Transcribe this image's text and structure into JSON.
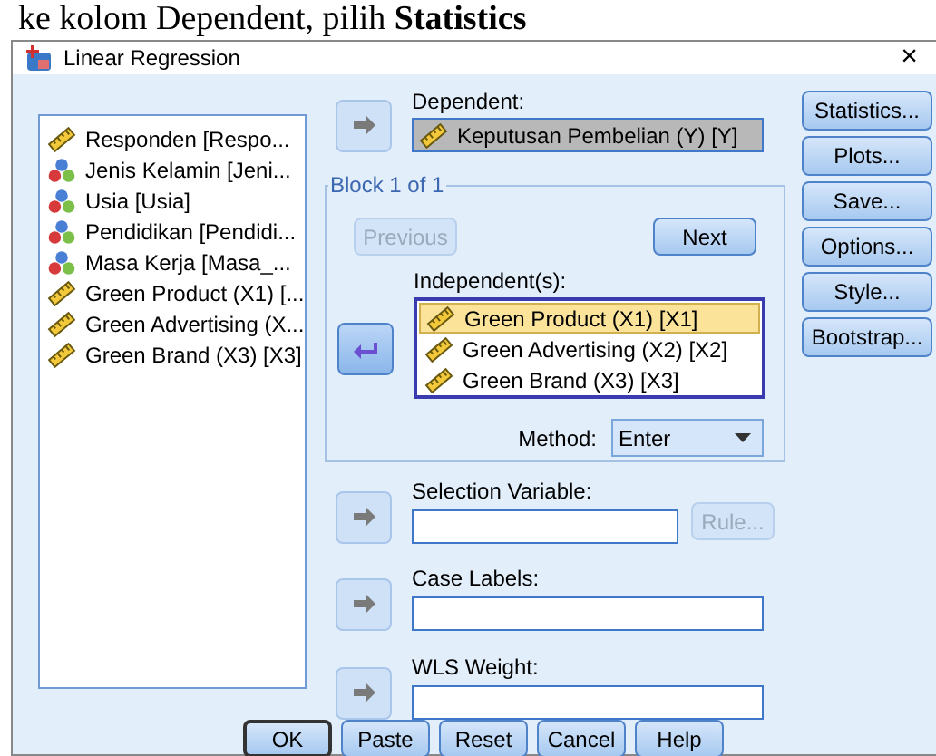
{
  "caption": "ke kolom Dependent, pilih **Statistics**",
  "window": {
    "title": "Linear Regression",
    "close": "×"
  },
  "variables": [
    {
      "label": "Responden [Respo...",
      "kind": "scale"
    },
    {
      "label": "Jenis Kelamin [Jeni...",
      "kind": "nominal"
    },
    {
      "label": "Usia [Usia]",
      "kind": "nominal"
    },
    {
      "label": "Pendidikan [Pendidi...",
      "kind": "nominal"
    },
    {
      "label": "Masa Kerja [Masa_...",
      "kind": "nominal"
    },
    {
      "label": "Green Product (X1) [...",
      "kind": "scale"
    },
    {
      "label": "Green Advertising (X...",
      "kind": "scale"
    },
    {
      "label": "Green Brand (X3) [X3]",
      "kind": "scale"
    }
  ],
  "dependent": {
    "label": "Dependent:",
    "arrow": {
      "kind": "right",
      "disabled": true
    },
    "value": {
      "label": "Keputusan Pembelian (Y) [Y]",
      "kind": "scale"
    }
  },
  "block": {
    "title": "Block 1 of 1",
    "previous": {
      "label": "Previous",
      "disabled": true
    },
    "next": {
      "label": "Next",
      "disabled": false
    },
    "independents_label": "Independent(s):",
    "arrow": {
      "kind": "left",
      "disabled": false
    },
    "independents": [
      {
        "label": "Green Product (X1) [X1]",
        "kind": "scale",
        "selected": true
      },
      {
        "label": "Green Advertising (X2) [X2]",
        "kind": "scale",
        "selected": false
      },
      {
        "label": "Green Brand (X3) [X3]",
        "kind": "scale",
        "selected": false
      }
    ],
    "method": {
      "label": "Method:",
      "value": "Enter"
    }
  },
  "selection_variable": {
    "label": "Selection Variable:",
    "arrow": {
      "kind": "right",
      "disabled": true
    },
    "rule": {
      "label": "Rule...",
      "disabled": true
    }
  },
  "case_labels": {
    "label": "Case Labels:",
    "arrow": {
      "kind": "right",
      "disabled": true
    }
  },
  "wls_weight": {
    "label": "WLS Weight:",
    "arrow": {
      "kind": "right",
      "disabled": true
    }
  },
  "side_buttons": [
    "Statistics...",
    "Plots...",
    "Save...",
    "Options...",
    "Style...",
    "Bootstrap..."
  ],
  "buttons": [
    {
      "label": "OK",
      "default": true
    },
    {
      "label": "Paste",
      "default": false
    },
    {
      "label": "Reset",
      "default": false
    },
    {
      "label": "Cancel",
      "default": false
    },
    {
      "label": "Help",
      "default": false
    }
  ]
}
